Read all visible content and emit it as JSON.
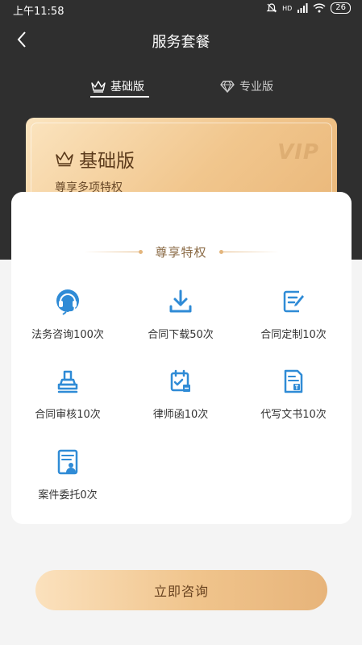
{
  "status_bar": {
    "time": "上午11:58",
    "battery": "26",
    "network": "HD"
  },
  "nav": {
    "title": "服务套餐"
  },
  "tabs": [
    {
      "label": "基础版",
      "icon": "crown-icon",
      "active": true
    },
    {
      "label": "专业版",
      "icon": "diamond-icon",
      "active": false
    }
  ],
  "vip_card": {
    "title": "基础版",
    "subtitle": "尊享多项特权",
    "watermark": "VIP"
  },
  "privileges": {
    "header": "尊享特权",
    "items": [
      {
        "label": "法务咨询100次",
        "icon": "headset-icon"
      },
      {
        "label": "合同下载50次",
        "icon": "download-icon"
      },
      {
        "label": "合同定制10次",
        "icon": "edit-document-icon"
      },
      {
        "label": "合同审核10次",
        "icon": "stamp-icon"
      },
      {
        "label": "律师函10次",
        "icon": "calendar-check-icon"
      },
      {
        "label": "代写文书10次",
        "icon": "document-text-icon"
      },
      {
        "label": "案件委托0次",
        "icon": "case-file-icon"
      }
    ]
  },
  "cta": {
    "label": "立即咨询"
  },
  "colors": {
    "accent_gold": "#e3b57d",
    "icon_blue": "#2f8bd6",
    "dark_header": "#2f2f2f"
  }
}
